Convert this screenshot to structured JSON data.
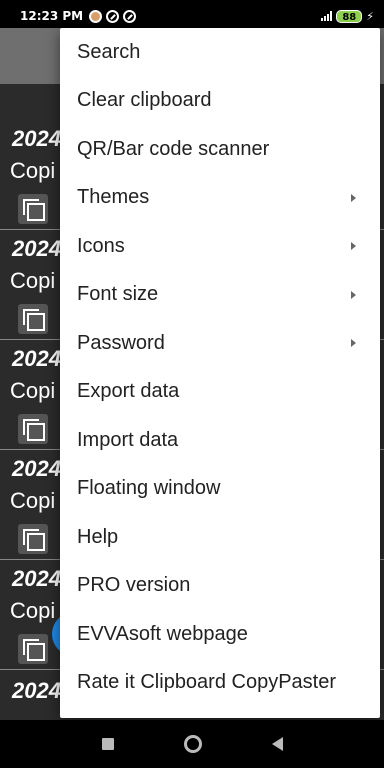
{
  "status_bar": {
    "time": "12:23 PM",
    "battery": "88",
    "icons": [
      "notification-app-icon",
      "sync-icon",
      "sync-icon"
    ],
    "right_icons": [
      "signal-icon",
      "battery-icon",
      "charging-bolt-icon"
    ]
  },
  "background_list": {
    "rows": [
      {
        "date": "2024",
        "text": "Copi"
      },
      {
        "date": "2024",
        "text": "Copi"
      },
      {
        "date": "2024",
        "text": "Copi"
      },
      {
        "date": "2024",
        "text": "Copi"
      },
      {
        "date": "2024",
        "text": "Copi"
      },
      {
        "date": "2024",
        "text": ""
      }
    ]
  },
  "menu": {
    "items": [
      {
        "label": "Search",
        "has_submenu": false
      },
      {
        "label": "Clear clipboard",
        "has_submenu": false
      },
      {
        "label": "QR/Bar code scanner",
        "has_submenu": false
      },
      {
        "label": "Themes",
        "has_submenu": true
      },
      {
        "label": "Icons",
        "has_submenu": true
      },
      {
        "label": "Font size",
        "has_submenu": true
      },
      {
        "label": "Password",
        "has_submenu": true
      },
      {
        "label": "Export data",
        "has_submenu": false
      },
      {
        "label": "Import data",
        "has_submenu": false
      },
      {
        "label": "Floating window",
        "has_submenu": false
      },
      {
        "label": "Help",
        "has_submenu": false
      },
      {
        "label": "PRO version",
        "has_submenu": false
      },
      {
        "label": "EVVAsoft webpage",
        "has_submenu": false
      },
      {
        "label": "Rate it Clipboard CopyPaster",
        "has_submenu": false
      }
    ]
  },
  "nav_bar": {
    "buttons": [
      "recents-button",
      "home-button",
      "back-button"
    ]
  }
}
